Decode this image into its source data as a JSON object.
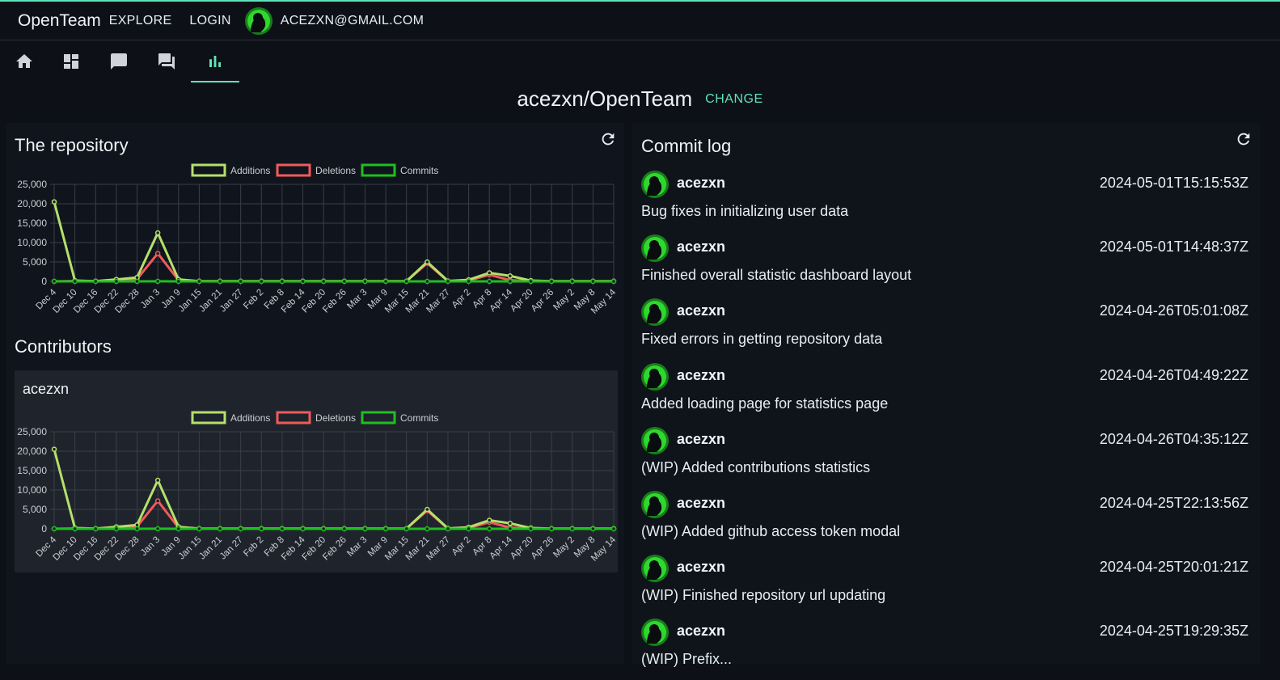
{
  "header": {
    "brand": "OpenTeam",
    "nav": [
      "EXPLORE",
      "LOGIN"
    ],
    "email": "ACEZXN@GMAIL.COM"
  },
  "icon_tabs": [
    {
      "name": "home-icon"
    },
    {
      "name": "dashboard-icon"
    },
    {
      "name": "chat-bubble-icon"
    },
    {
      "name": "forum-icon"
    },
    {
      "name": "bar-chart-icon",
      "active": true
    }
  ],
  "repo": {
    "name": "acezxn/OpenTeam",
    "change_label": "CHANGE"
  },
  "repository_section": {
    "title": "The repository"
  },
  "contributors_section": {
    "title": "Contributors",
    "contributor": "acezxn"
  },
  "commit_log": {
    "title": "Commit log",
    "commits": [
      {
        "user": "acezxn",
        "date": "2024-05-01T15:15:53Z",
        "message": "Bug fixes in initializing user data"
      },
      {
        "user": "acezxn",
        "date": "2024-05-01T14:48:37Z",
        "message": "Finished overall statistic dashboard layout"
      },
      {
        "user": "acezxn",
        "date": "2024-04-26T05:01:08Z",
        "message": "Fixed errors in getting repository data"
      },
      {
        "user": "acezxn",
        "date": "2024-04-26T04:49:22Z",
        "message": "Added loading page for statistics page"
      },
      {
        "user": "acezxn",
        "date": "2024-04-26T04:35:12Z",
        "message": "(WIP) Added contributions statistics"
      },
      {
        "user": "acezxn",
        "date": "2024-04-25T22:13:56Z",
        "message": "(WIP) Added github access token modal"
      },
      {
        "user": "acezxn",
        "date": "2024-04-25T20:01:21Z",
        "message": "(WIP) Finished repository url updating"
      },
      {
        "user": "acezxn",
        "date": "2024-04-25T19:29:35Z",
        "message": "(WIP) Prefix..."
      }
    ]
  },
  "colors": {
    "accent": "#5fe3b8",
    "additions": "#b5e06a",
    "deletions": "#f05a5a",
    "commits": "#1fbf1f"
  },
  "chart_data": [
    {
      "type": "line",
      "legend_position": "top",
      "grid": true,
      "categories": [
        "Dec 4",
        "Dec 10",
        "Dec 16",
        "Dec 22",
        "Dec 28",
        "Jan 3",
        "Jan 9",
        "Jan 15",
        "Jan 21",
        "Jan 27",
        "Feb 2",
        "Feb 8",
        "Feb 14",
        "Feb 20",
        "Feb 26",
        "Mar 3",
        "Mar 9",
        "Mar 15",
        "Mar 21",
        "Mar 27",
        "Apr 2",
        "Apr 8",
        "Apr 14",
        "Apr 20",
        "Apr 26",
        "May 2",
        "May 8",
        "May 14"
      ],
      "ylim": [
        0,
        25000
      ],
      "yticks": [
        0,
        5000,
        10000,
        15000,
        20000,
        25000
      ],
      "ytick_labels": [
        "0",
        "5,000",
        "10,000",
        "15,000",
        "20,000",
        "25,000"
      ],
      "series": [
        {
          "name": "Additions",
          "color": "#b5e06a",
          "values": [
            20500,
            200,
            50,
            500,
            1000,
            12500,
            500,
            50,
            50,
            50,
            50,
            50,
            50,
            50,
            50,
            50,
            50,
            50,
            5000,
            100,
            400,
            2200,
            1400,
            200,
            50,
            50,
            50,
            50
          ]
        },
        {
          "name": "Deletions",
          "color": "#f05a5a",
          "values": [
            0,
            100,
            50,
            200,
            600,
            7200,
            300,
            50,
            50,
            50,
            50,
            50,
            50,
            50,
            50,
            50,
            50,
            50,
            4700,
            50,
            200,
            1700,
            300,
            100,
            50,
            50,
            50,
            50
          ]
        },
        {
          "name": "Commits",
          "color": "#1fbf1f",
          "values": [
            30,
            5,
            2,
            5,
            8,
            20,
            5,
            1,
            1,
            1,
            1,
            1,
            1,
            1,
            1,
            1,
            1,
            1,
            12,
            2,
            3,
            10,
            6,
            2,
            1,
            1,
            1,
            1
          ]
        }
      ]
    },
    {
      "type": "line",
      "legend_position": "top",
      "grid": true,
      "categories": [
        "Dec 4",
        "Dec 10",
        "Dec 16",
        "Dec 22",
        "Dec 28",
        "Jan 3",
        "Jan 9",
        "Jan 15",
        "Jan 21",
        "Jan 27",
        "Feb 2",
        "Feb 8",
        "Feb 14",
        "Feb 20",
        "Feb 26",
        "Mar 3",
        "Mar 9",
        "Mar 15",
        "Mar 21",
        "Mar 27",
        "Apr 2",
        "Apr 8",
        "Apr 14",
        "Apr 20",
        "Apr 26",
        "May 2",
        "May 8",
        "May 14"
      ],
      "ylim": [
        0,
        25000
      ],
      "yticks": [
        0,
        5000,
        10000,
        15000,
        20000,
        25000
      ],
      "ytick_labels": [
        "0",
        "5,000",
        "10,000",
        "15,000",
        "20,000",
        "25,000"
      ],
      "series": [
        {
          "name": "Additions",
          "color": "#b5e06a",
          "values": [
            20500,
            200,
            50,
            500,
            1000,
            12500,
            500,
            50,
            50,
            50,
            50,
            50,
            50,
            50,
            50,
            50,
            50,
            50,
            5000,
            100,
            400,
            2200,
            1400,
            200,
            50,
            50,
            50,
            50
          ]
        },
        {
          "name": "Deletions",
          "color": "#f05a5a",
          "values": [
            0,
            100,
            50,
            200,
            600,
            7200,
            300,
            50,
            50,
            50,
            50,
            50,
            50,
            50,
            50,
            50,
            50,
            50,
            4700,
            50,
            200,
            1700,
            300,
            100,
            50,
            50,
            50,
            50
          ]
        },
        {
          "name": "Commits",
          "color": "#1fbf1f",
          "values": [
            30,
            5,
            2,
            5,
            8,
            20,
            5,
            1,
            1,
            1,
            1,
            1,
            1,
            1,
            1,
            1,
            1,
            1,
            12,
            2,
            3,
            10,
            6,
            2,
            1,
            1,
            1,
            1
          ]
        }
      ]
    }
  ]
}
